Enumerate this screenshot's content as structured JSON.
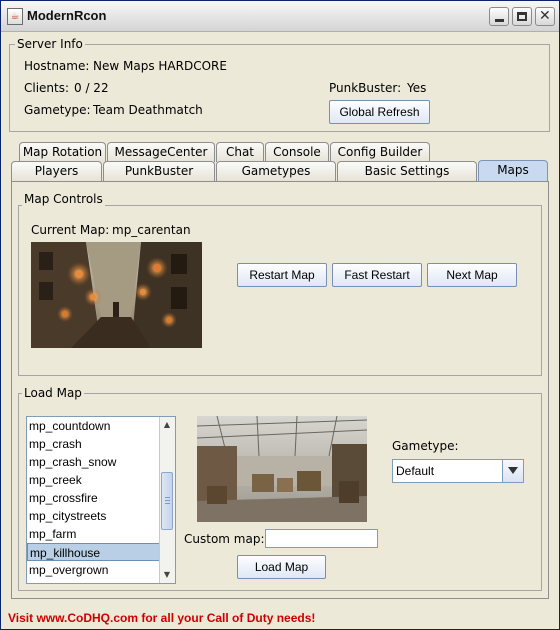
{
  "window": {
    "title": "ModernRcon"
  },
  "server_info": {
    "title": "Server Info",
    "hostname_label": "Hostname:",
    "hostname_value": "New Maps HARDCORE",
    "clients_label": "Clients:",
    "clients_value": "0 / 22",
    "gametype_label": "Gametype:",
    "gametype_value": "Team Deathmatch",
    "punkbuster_label": "PunkBuster:",
    "punkbuster_value": "Yes",
    "refresh_button": "Global Refresh"
  },
  "tabs": {
    "row1": [
      "Map Rotation",
      "MessageCenter",
      "Chat",
      "Console",
      "Config Builder"
    ],
    "row2": [
      "Players",
      "PunkBuster",
      "Gametypes",
      "Basic Settings",
      "Maps"
    ],
    "selected": "Maps"
  },
  "map_controls": {
    "title": "Map Controls",
    "current_map_label": "Current Map:",
    "current_map_value": "mp_carentan",
    "restart_button": "Restart Map",
    "fast_restart_button": "Fast Restart",
    "next_map_button": "Next Map"
  },
  "load_map": {
    "title": "Load Map",
    "maps": [
      "mp_countdown",
      "mp_crash",
      "mp_crash_snow",
      "mp_creek",
      "mp_crossfire",
      "mp_citystreets",
      "mp_farm",
      "mp_killhouse",
      "mp_overgrown"
    ],
    "selected_map": "mp_killhouse",
    "gametype_label": "Gametype:",
    "gametype_value": "Default",
    "custom_map_label": "Custom map:",
    "custom_map_value": "",
    "load_button": "Load Map"
  },
  "status_text": "Visit www.CoDHQ.com for all your Call of Duty needs!",
  "icons": {
    "app": "java-cup-icon",
    "minimize": "minimize-icon",
    "maximize": "maximize-icon",
    "close": "close-icon"
  }
}
